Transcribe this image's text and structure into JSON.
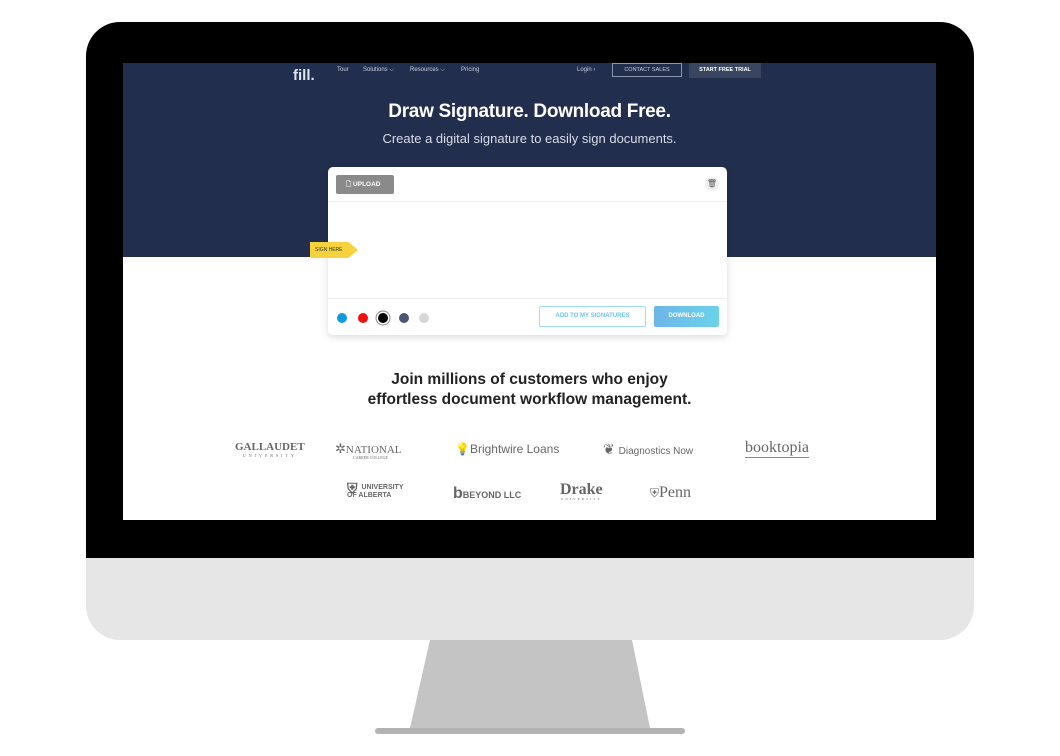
{
  "nav": {
    "logo": "fill.",
    "items": [
      "Tour",
      "Solutions ⌵",
      "Resources ⌵",
      "Pricing"
    ],
    "login": "Login ›",
    "contact": "CONTACT SALES",
    "trial": "START FREE TRIAL"
  },
  "hero": {
    "title": "Draw Signature. Download Free.",
    "subtitle": "Create a digital signature to easily sign documents."
  },
  "pad": {
    "upload": "UPLOAD",
    "sign_here": "SIGN HERE",
    "add": "ADD TO MY SIGNATURES",
    "download": "DOWNLOAD",
    "colors": [
      "#109bde",
      "#f01010",
      "#000000",
      "#4a5575",
      "#d6d6d6"
    ],
    "selected_color": "#000000"
  },
  "social": {
    "line1": "Join millions of customers who enjoy",
    "line2": "effortless document workflow management."
  },
  "logos": [
    "GALLAUDET",
    "UNIVERSITY",
    "NATIONAL",
    "CAREER COLLEGE",
    "Brightwire Loans",
    "Diagnostics Now",
    "booktopia",
    "UNIVERSITY",
    "OF ALBERTA",
    "BEYOND LLC",
    "Drake",
    "UNIVERSITY",
    "Penn"
  ]
}
